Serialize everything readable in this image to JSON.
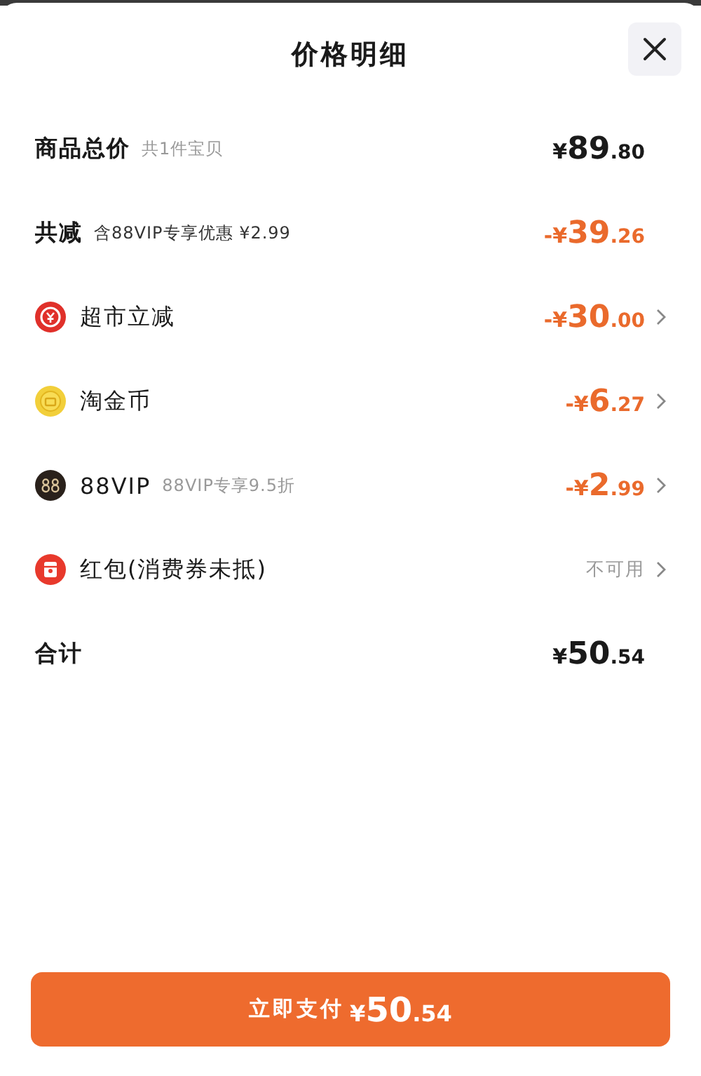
{
  "title": "价格明细",
  "rows": [
    {
      "kind": "subtotal",
      "label": "商品总价",
      "note": "共1件宝贝",
      "amount": "¥89.80"
    },
    {
      "kind": "saving",
      "label": "共减",
      "note": "含88VIP专享优惠 ¥2.99",
      "amount": "-¥39.26"
    },
    {
      "kind": "coupon",
      "label": "超市立减",
      "amount": "-¥30.00",
      "arrow": true
    },
    {
      "kind": "coin",
      "label": "淘金币",
      "amount": "-¥6.27",
      "arrow": true
    },
    {
      "kind": "vip",
      "label": "88VIP",
      "note": "88VIP专享9.5折",
      "amount": "-¥2.99",
      "arrow": true
    },
    {
      "kind": "packet",
      "label": "红包(消费券未抵)",
      "amount": "不可用",
      "arrow": true
    },
    {
      "kind": "total",
      "label": "合计",
      "amount": "¥50.54"
    }
  ],
  "pay_button": {
    "label": "立即支付",
    "amount": "¥50.54"
  }
}
